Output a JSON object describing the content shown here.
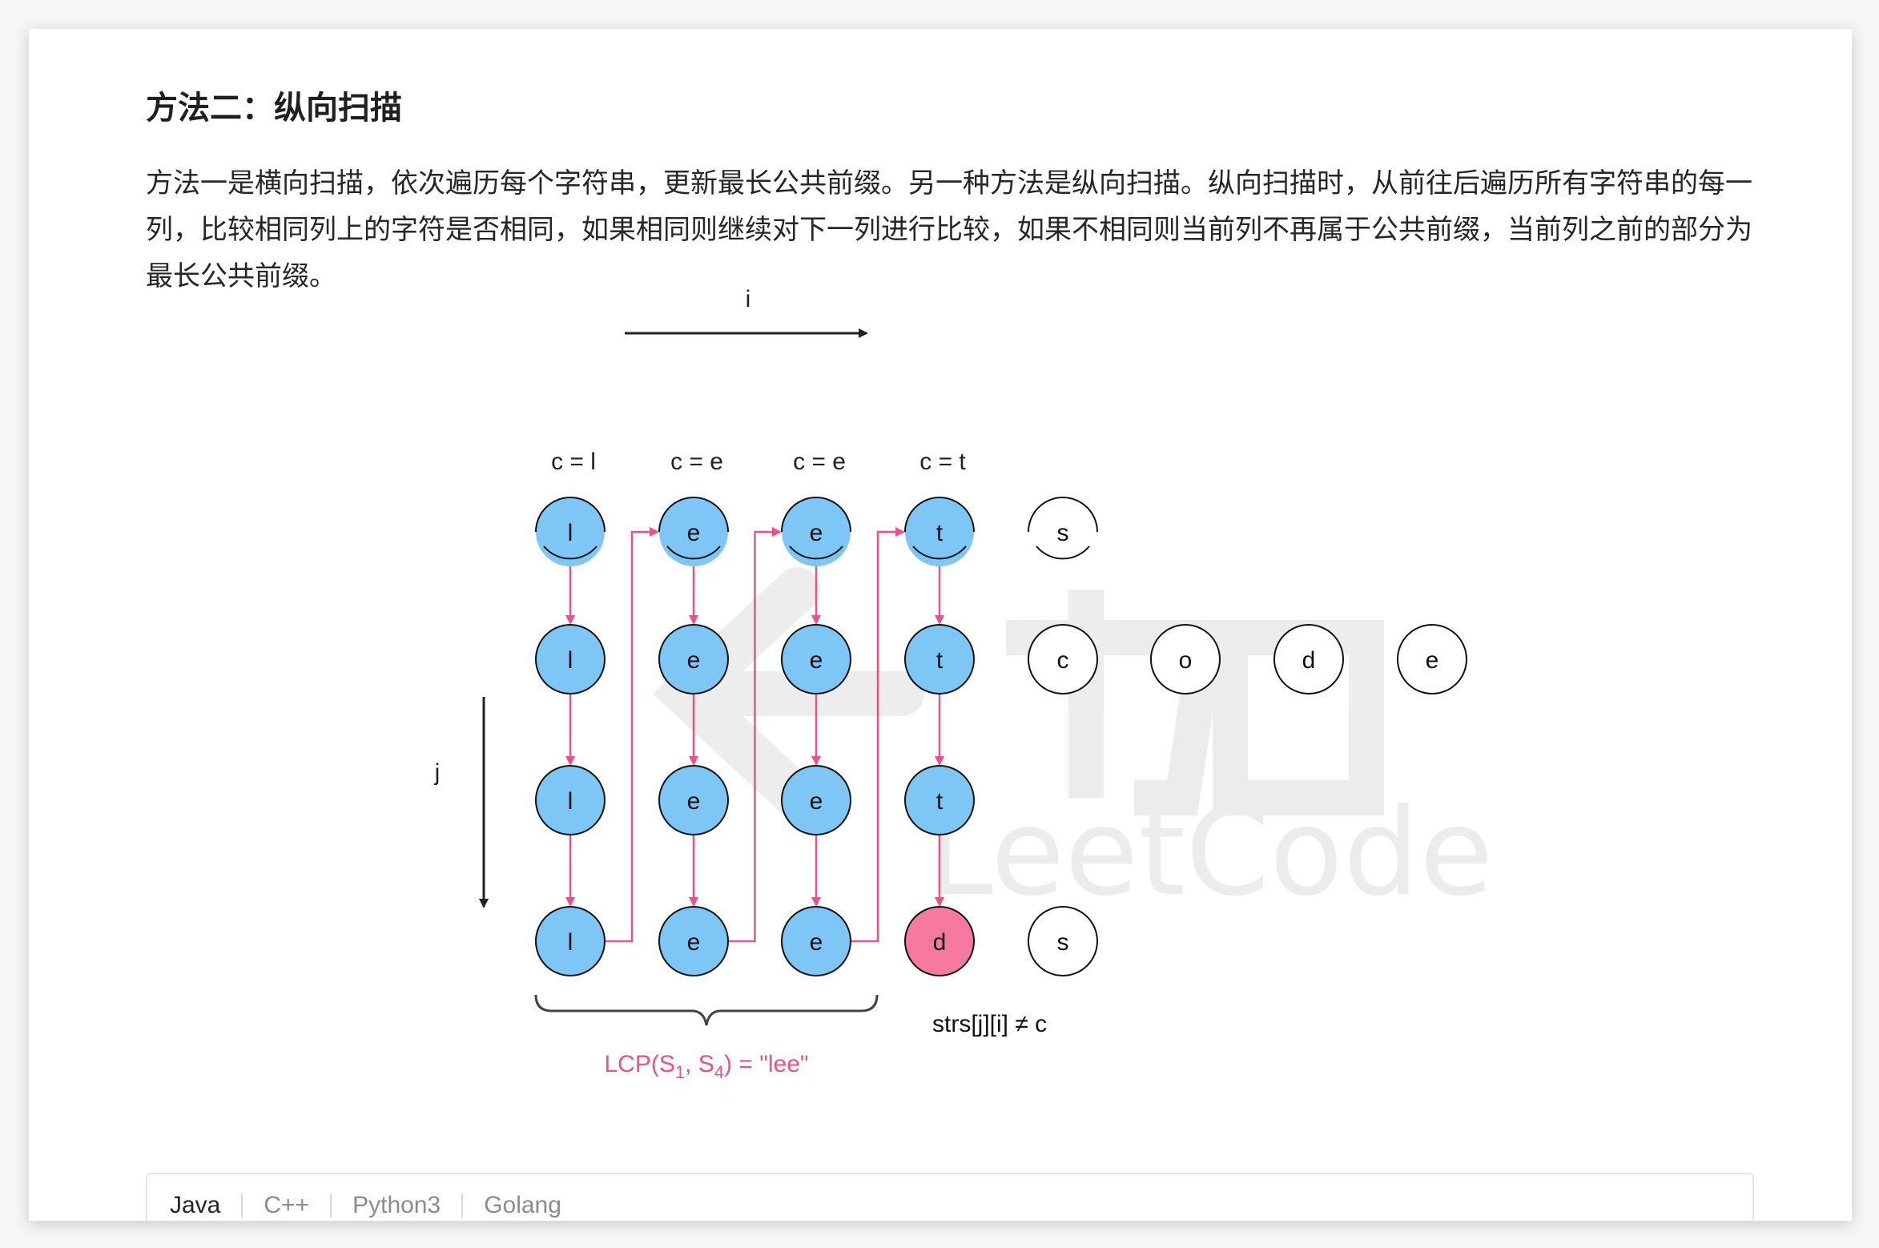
{
  "heading": "方法二：纵向扫描",
  "paragraph": "方法一是横向扫描，依次遍历每个字符串，更新最长公共前缀。另一种方法是纵向扫描。纵向扫描时，从前往后遍历所有字符串的每一列，比较相同列上的字符是否相同，如果相同则继续对下一列进行比较，如果不相同则当前列不再属于公共前缀，当前列之前的部分为最长公共前缀。",
  "diagram": {
    "i_label": "i",
    "j_label": "j",
    "column_labels": [
      "c = l",
      "c = e",
      "c = e",
      "c = t"
    ],
    "strings": [
      [
        "l",
        "e",
        "e",
        "t",
        "s"
      ],
      [
        "l",
        "e",
        "e",
        "t",
        "c",
        "o",
        "d",
        "e"
      ],
      [
        "l",
        "e",
        "e",
        "t"
      ],
      [
        "l",
        "e",
        "e",
        "d",
        "s"
      ]
    ],
    "mismatch_label": "strs[j][i] ≠ c",
    "lcp_prefix": "LCP(S",
    "lcp_sub1": "1",
    "lcp_mid": ", S",
    "lcp_sub2": "4",
    "lcp_suffix": ") = \"lee\"",
    "watermark_text": "LeetCode",
    "colors": {
      "match_fill": "#7ec6f5",
      "mismatch_fill": "#f67aa0",
      "arrow": "#f0508a"
    }
  },
  "code_tabs": [
    "Java",
    "C++",
    "Python3",
    "Golang"
  ],
  "active_tab": "Java"
}
